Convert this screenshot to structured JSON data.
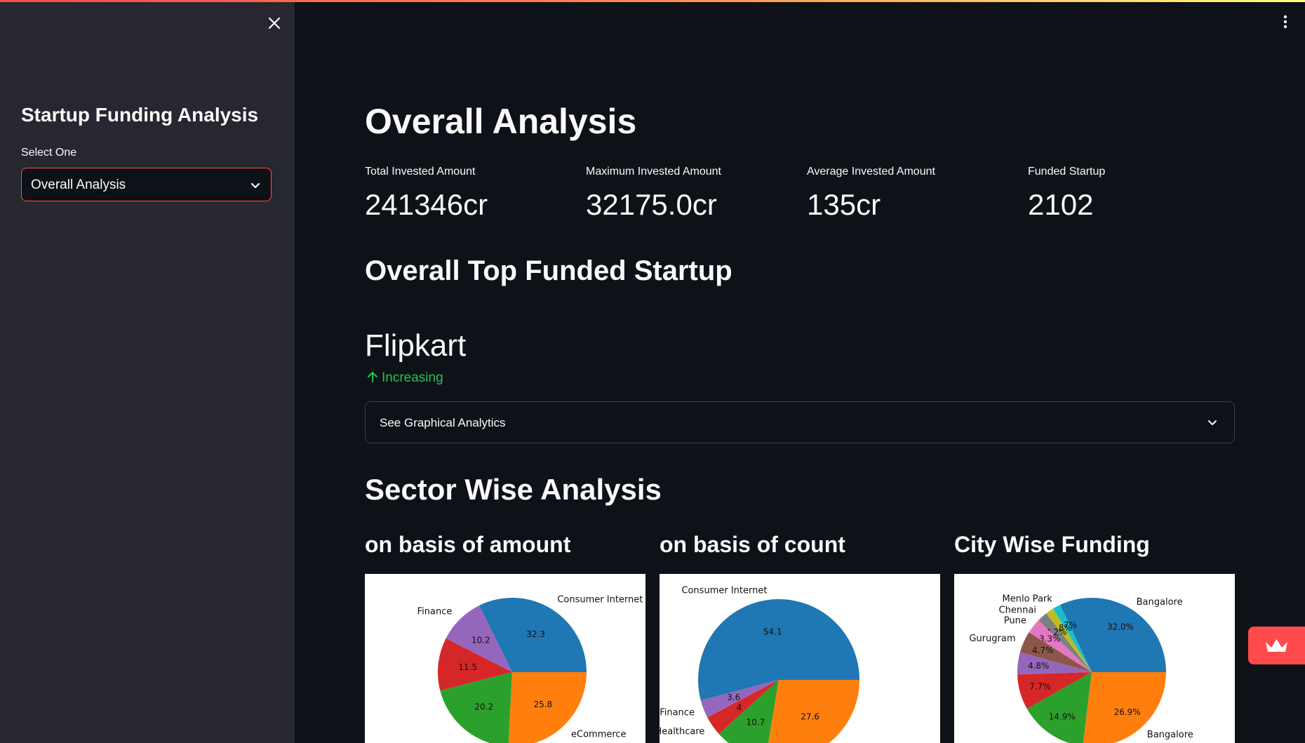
{
  "sidebar": {
    "title": "Startup Funding Analysis",
    "select_label": "Select One",
    "select_value": "Overall Analysis"
  },
  "main": {
    "title": "Overall Analysis",
    "metrics": [
      {
        "label": "Total Invested Amount",
        "value": "241346cr"
      },
      {
        "label": "Maximum Invested Amount",
        "value": "32175.0cr"
      },
      {
        "label": "Average Invested Amount",
        "value": "135cr"
      },
      {
        "label": "Funded Startup",
        "value": "2102"
      }
    ],
    "top_funded_heading": "Overall Top Funded Startup",
    "top_funded_name": "Flipkart",
    "top_funded_delta": "Increasing",
    "expander_label": "See Graphical Analytics",
    "sector_heading": "Sector Wise Analysis",
    "chart_headings": [
      "on basis of amount",
      "on basis of count",
      "City Wise Funding"
    ]
  },
  "colors": {
    "accent": "#ff4b4b",
    "positive": "#21c354",
    "bg": "#0e1117",
    "sidebar_bg": "#262730"
  },
  "icons": {
    "close": "close-icon",
    "select_chevron": "chevron-down-icon",
    "menu": "kebab-menu-icon",
    "delta": "arrow-up-icon",
    "expander_chevron": "chevron-down-icon",
    "fab": "crown-icon"
  },
  "chart_data": [
    {
      "type": "pie",
      "title": "on basis of amount",
      "slices": [
        {
          "label": "Consumer Internet",
          "value": 32.3,
          "color": "#1f77b4"
        },
        {
          "label": "Finance",
          "value": 10.2,
          "color": "#9467bd"
        },
        {
          "label": "",
          "value": 11.5,
          "color": "#d62728"
        },
        {
          "label": "",
          "value": 20.2,
          "color": "#2ca02c"
        },
        {
          "label": "eCommerce",
          "value": 25.8,
          "color": "#ff7f0e"
        }
      ]
    },
    {
      "type": "pie",
      "title": "on basis of count",
      "slices": [
        {
          "label": "Consumer Internet",
          "value": 54.1,
          "color": "#1f77b4"
        },
        {
          "label": "Finance",
          "value": 3.6,
          "color": "#9467bd"
        },
        {
          "label": "Healthcare",
          "value": 4.0,
          "color": "#d62728"
        },
        {
          "label": "",
          "value": 10.7,
          "color": "#2ca02c"
        },
        {
          "label": "",
          "value": 27.6,
          "color": "#ff7f0e"
        }
      ]
    },
    {
      "type": "pie",
      "title": "City Wise Funding",
      "slices": [
        {
          "label": "Bangalore",
          "value": 32.0,
          "pct": "32.0%",
          "color": "#1f77b4"
        },
        {
          "label": "Menlo Park",
          "value": 1.7,
          "pct": "1.7%",
          "color": "#17becf"
        },
        {
          "label": "",
          "value": 1.8,
          "pct": "1.8%",
          "color": "#bcbd22"
        },
        {
          "label": "Chennai",
          "value": 2.2,
          "pct": "2.2%",
          "color": "#7f7f7f"
        },
        {
          "label": "Pune",
          "value": 3.3,
          "pct": "3.3%",
          "color": "#e377c2"
        },
        {
          "label": "Gurugram",
          "value": 4.7,
          "pct": "4.7%",
          "color": "#8c564b"
        },
        {
          "label": "",
          "value": 4.8,
          "pct": "4.8%",
          "color": "#9467bd"
        },
        {
          "label": "",
          "value": 7.7,
          "pct": "7.7%",
          "color": "#d62728"
        },
        {
          "label": "",
          "value": 14.9,
          "pct": "14.9%",
          "color": "#2ca02c"
        },
        {
          "label": "Bangalore",
          "value": 26.9,
          "pct": "26.9%",
          "color": "#ff7f0e"
        }
      ]
    }
  ]
}
